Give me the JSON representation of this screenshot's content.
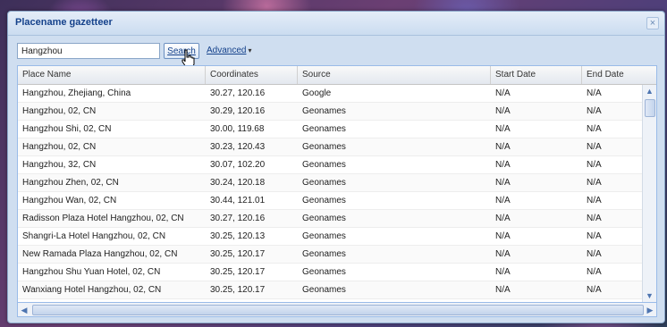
{
  "window": {
    "title": "Placename gazetteer",
    "close_glyph": "×"
  },
  "search": {
    "value": "Hangzhou",
    "button_label": "Search",
    "advanced_label": "Advanced",
    "advanced_caret": "▾"
  },
  "grid": {
    "columns": [
      "Place Name",
      "Coordinates",
      "Source",
      "Start Date",
      "End Date"
    ],
    "rows": [
      [
        "Hangzhou, Zhejiang, China",
        "30.27, 120.16",
        "Google",
        "N/A",
        "N/A"
      ],
      [
        "Hangzhou, 02, CN",
        "30.29, 120.16",
        "Geonames",
        "N/A",
        "N/A"
      ],
      [
        "Hangzhou Shi, 02, CN",
        "30.00, 119.68",
        "Geonames",
        "N/A",
        "N/A"
      ],
      [
        "Hangzhou, 02, CN",
        "30.23, 120.43",
        "Geonames",
        "N/A",
        "N/A"
      ],
      [
        "Hangzhou, 32, CN",
        "30.07, 102.20",
        "Geonames",
        "N/A",
        "N/A"
      ],
      [
        "Hangzhou Zhen, 02, CN",
        "30.24, 120.18",
        "Geonames",
        "N/A",
        "N/A"
      ],
      [
        "Hangzhou Wan, 02, CN",
        "30.44, 121.01",
        "Geonames",
        "N/A",
        "N/A"
      ],
      [
        "Radisson Plaza Hotel Hangzhou, 02, CN",
        "30.27, 120.16",
        "Geonames",
        "N/A",
        "N/A"
      ],
      [
        "Shangri-La Hotel Hangzhou, 02, CN",
        "30.25, 120.13",
        "Geonames",
        "N/A",
        "N/A"
      ],
      [
        "New Ramada Plaza Hangzhou, 02, CN",
        "30.25, 120.17",
        "Geonames",
        "N/A",
        "N/A"
      ],
      [
        "Hangzhou Shu Yuan Hotel, 02, CN",
        "30.25, 120.17",
        "Geonames",
        "N/A",
        "N/A"
      ],
      [
        "Wanxiang Hotel Hangzhou, 02, CN",
        "30.25, 120.17",
        "Geonames",
        "N/A",
        "N/A"
      ]
    ]
  },
  "scrollbars": {
    "up_glyph": "▲",
    "down_glyph": "▼",
    "left_glyph": "◀",
    "right_glyph": "▶"
  },
  "icons": {
    "close": "close-icon",
    "cursor": "hand-cursor-icon",
    "caret": "chevron-down-icon"
  },
  "colors": {
    "title_text": "#15428b",
    "panel_bg": "#cfdef0",
    "grid_border": "#99bbe8"
  }
}
